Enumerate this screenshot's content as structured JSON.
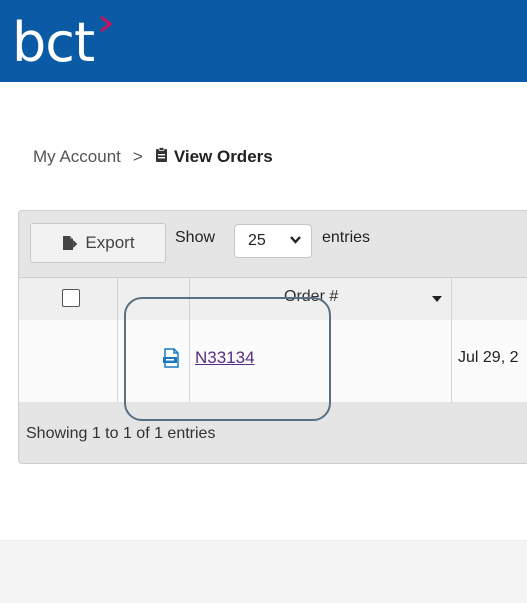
{
  "brand": {
    "logo_text": "bct"
  },
  "breadcrumb": {
    "root": "My Account",
    "separator": ">",
    "current": "View Orders"
  },
  "toolbar": {
    "export_label": "Export",
    "show_label": "Show",
    "page_size": "25",
    "entries_label": "entries"
  },
  "table": {
    "headers": {
      "order": "Order #"
    },
    "rows": [
      {
        "order_number": "N33134",
        "date": "Jul 29, 2"
      }
    ]
  },
  "footer": {
    "info": "Showing 1 to 1 of 1 entries"
  },
  "colors": {
    "brand_blue": "#0b5aa6",
    "accent": "#c2185b",
    "link": "#5a2d82"
  }
}
